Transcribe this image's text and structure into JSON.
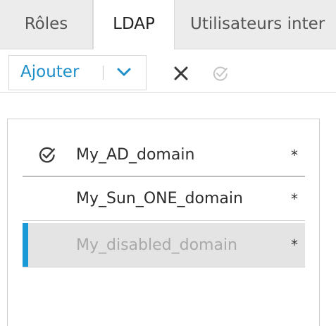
{
  "tabs": {
    "roles": "Rôles",
    "ldap": "LDAP",
    "internal_users": "Utilisateurs inter"
  },
  "toolbar": {
    "add_label": "Ajouter",
    "dropdown_icon": "chevron-down-icon",
    "delete_icon": "close-icon",
    "set_default_icon": "check-circle-icon",
    "accent_color": "#1f8fc9"
  },
  "domains": [
    {
      "name": "My_AD_domain",
      "marker": "*",
      "is_default": true,
      "disabled": false
    },
    {
      "name": "My_Sun_ONE_domain",
      "marker": "*",
      "is_default": false,
      "disabled": false
    },
    {
      "name": "My_disabled_domain",
      "marker": "*",
      "is_default": false,
      "disabled": true,
      "selected": true
    }
  ],
  "colors": {
    "selection_accent": "#1a9ad6",
    "selected_row_bg": "#e4e4e4",
    "disabled_text": "#a9a9a9"
  }
}
